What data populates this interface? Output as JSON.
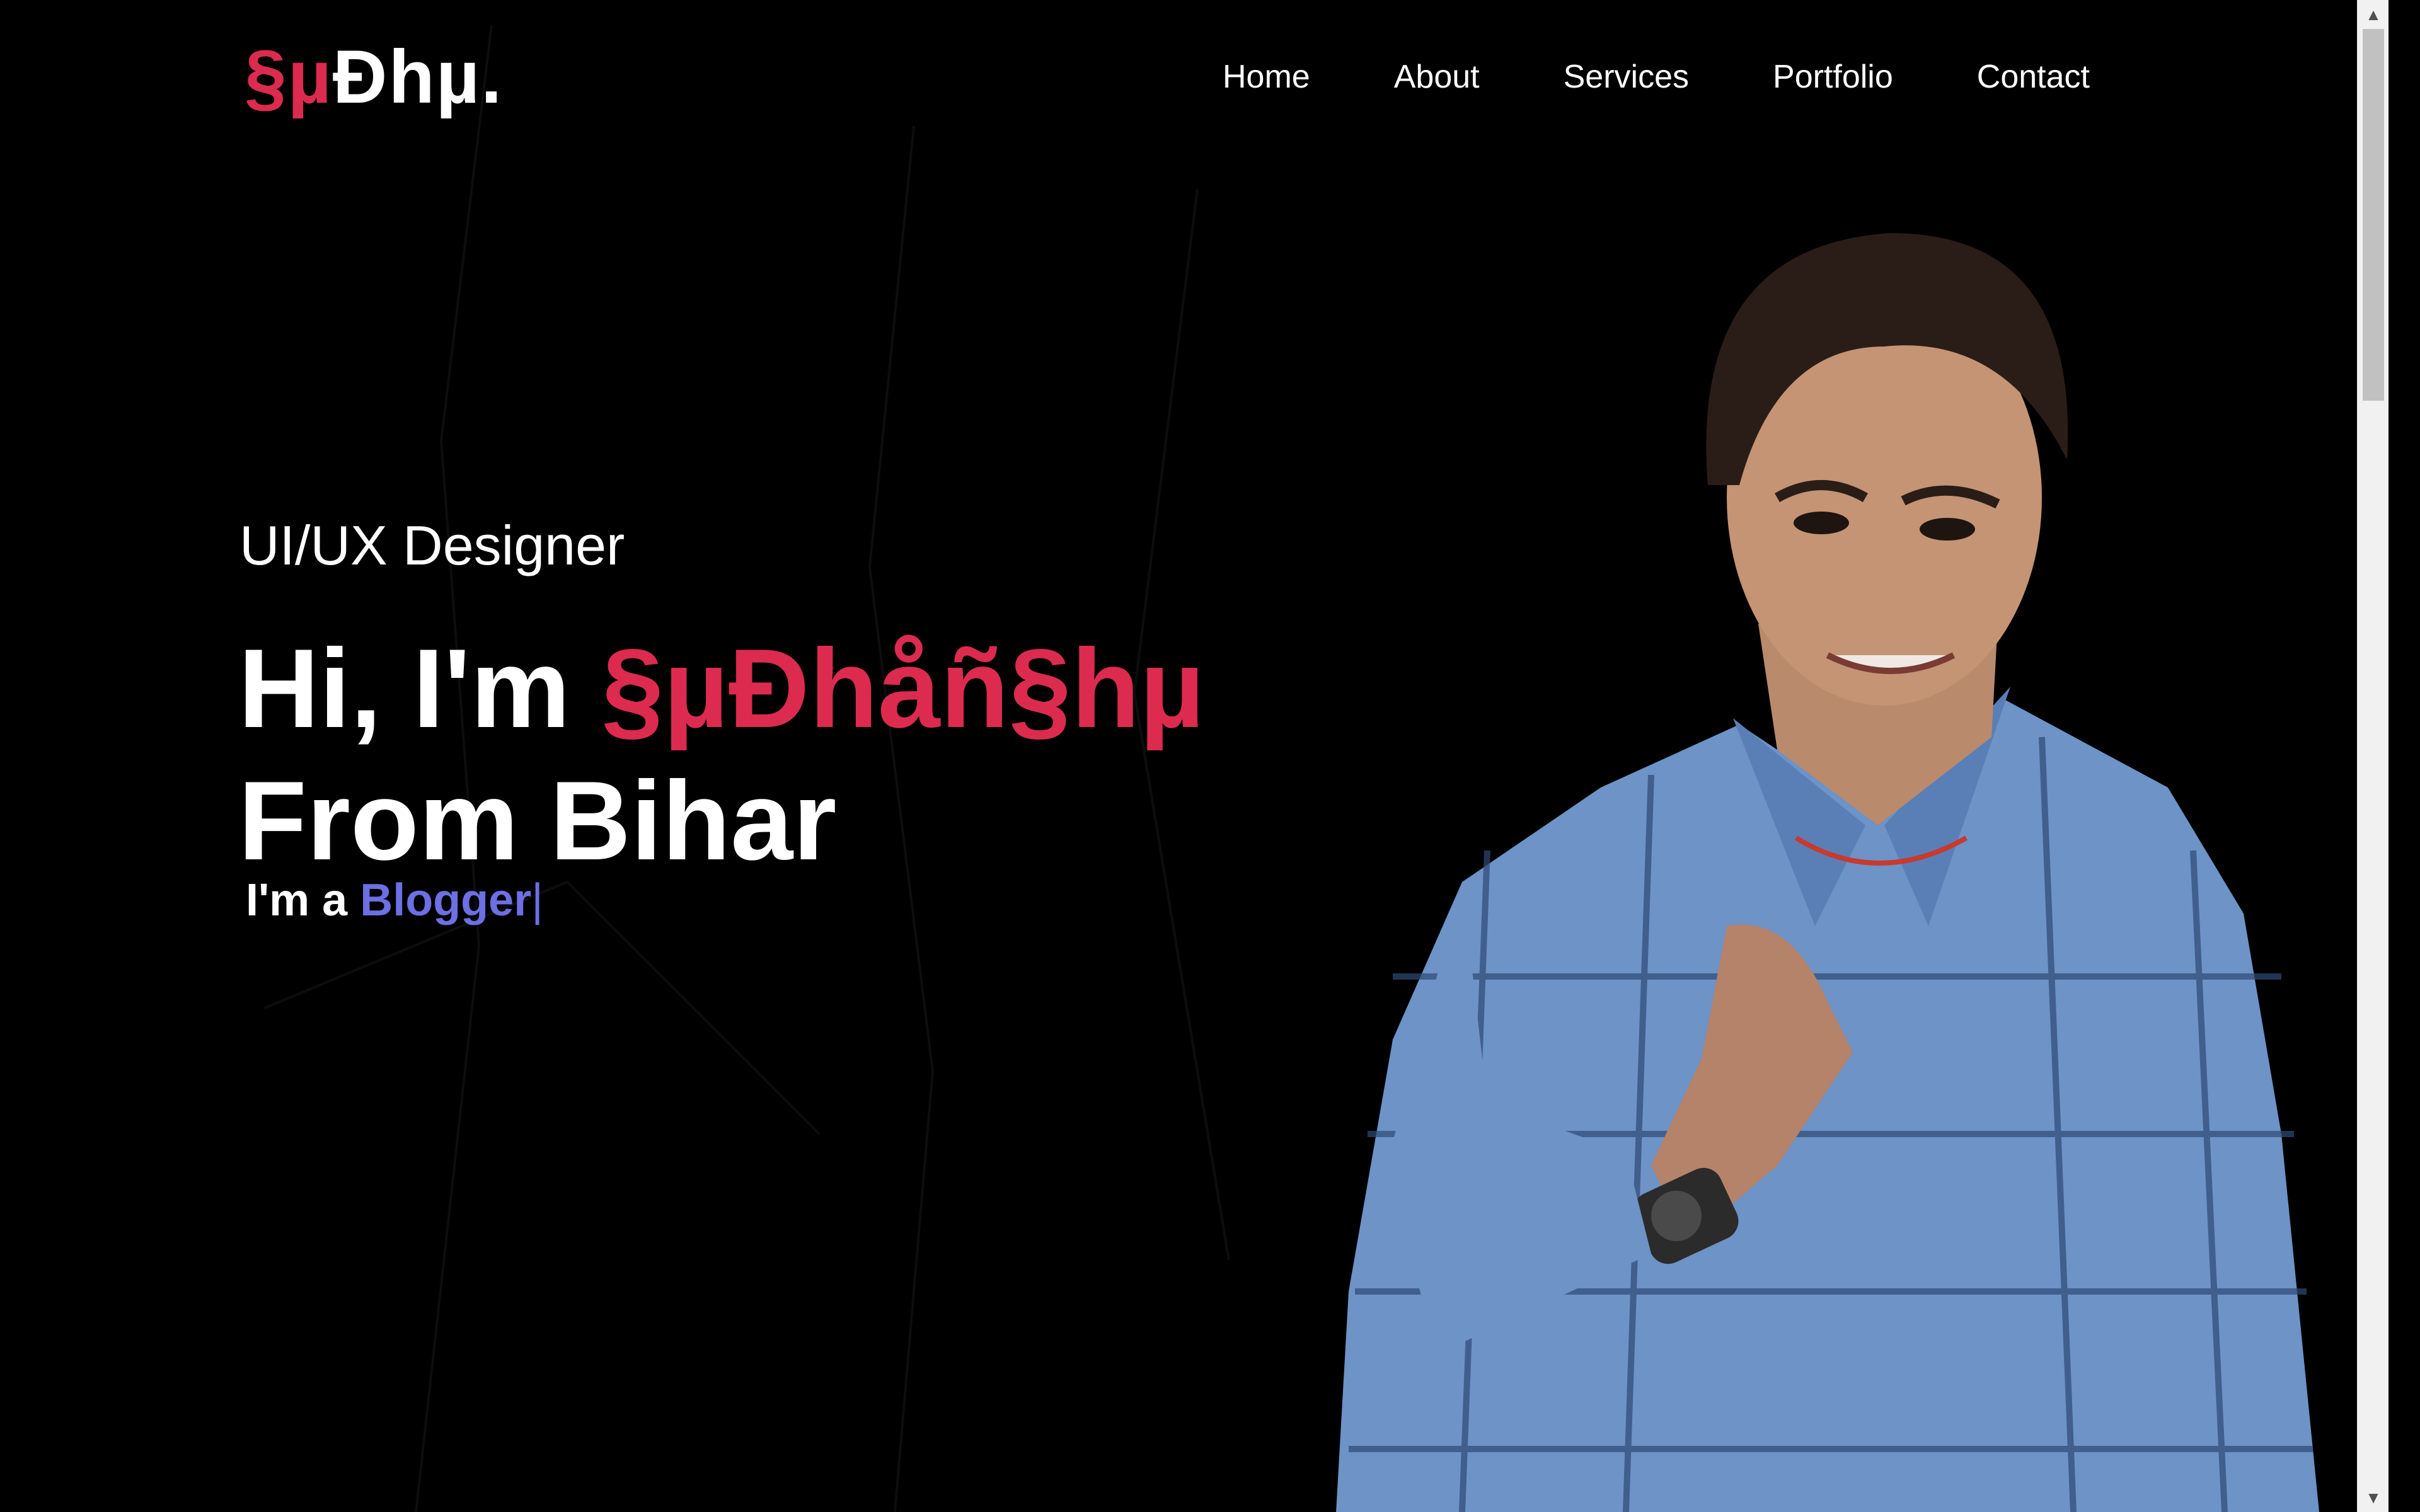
{
  "logo": {
    "accent": "§µ",
    "main": "Ðhµ."
  },
  "nav": {
    "items": [
      {
        "label": "Home"
      },
      {
        "label": "About"
      },
      {
        "label": "Services"
      },
      {
        "label": "Portfolio"
      },
      {
        "label": "Contact"
      }
    ]
  },
  "hero": {
    "subtitle": "UI/UX Designer",
    "greeting": "Hi, I'm ",
    "name": "§µÐhåñ§hµ",
    "line2": "From Bihar",
    "typed_prefix": "I'm a ",
    "typed_role": "Blogger",
    "typed_cursor": "|"
  },
  "colors": {
    "background": "#000000",
    "accent": "#dc2b4f",
    "typed": "#6d6fe3",
    "text": "#ffffff"
  },
  "icons": {
    "scroll_up": "chevron-up-icon",
    "scroll_down": "chevron-down-icon"
  }
}
